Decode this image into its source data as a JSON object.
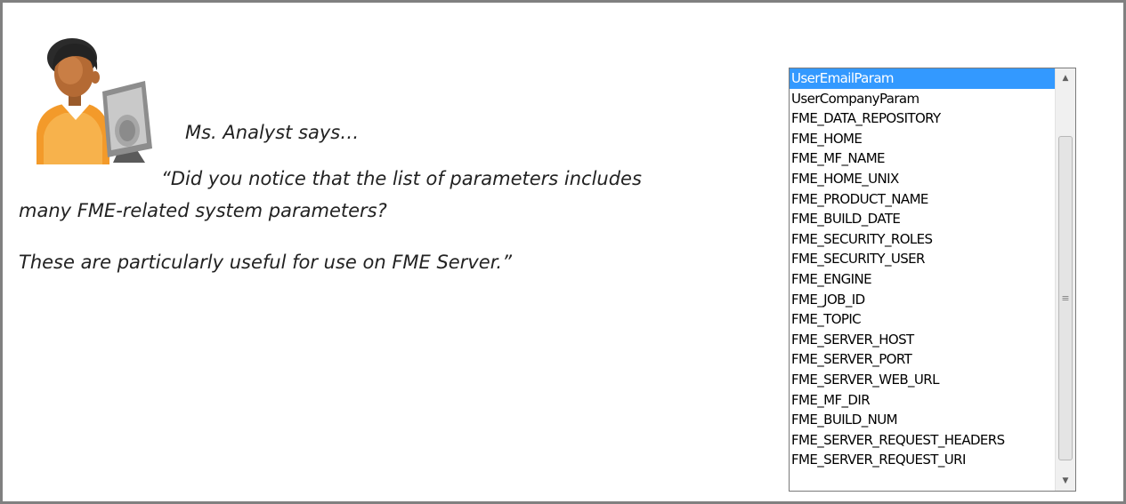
{
  "speaker": "Ms. Analyst says…",
  "quote": {
    "line1": "“Did you notice that the list of parameters includes",
    "line2": "many FME-related system parameters?",
    "line3": "These are particularly useful for use on FME Server.”"
  },
  "listbox": {
    "selected_index": 0,
    "items": [
      "UserEmailParam",
      "UserCompanyParam",
      "FME_DATA_REPOSITORY",
      "FME_HOME",
      "FME_MF_NAME",
      "FME_HOME_UNIX",
      "FME_PRODUCT_NAME",
      "FME_BUILD_DATE",
      "FME_SECURITY_ROLES",
      "FME_SECURITY_USER",
      "FME_ENGINE",
      "FME_JOB_ID",
      "FME_TOPIC",
      "FME_SERVER_HOST",
      "FME_SERVER_PORT",
      "FME_SERVER_WEB_URL",
      "FME_MF_DIR",
      "FME_BUILD_NUM",
      "FME_SERVER_REQUEST_HEADERS",
      "FME_SERVER_REQUEST_URI"
    ]
  },
  "icons": {
    "avatar": "analyst-avatar-icon",
    "scroll_up": "scroll-up-arrow-icon",
    "scroll_down": "scroll-down-arrow-icon",
    "grip": "scroll-grip-icon"
  },
  "colors": {
    "selection": "#3399ff",
    "frame_border": "#808080"
  }
}
